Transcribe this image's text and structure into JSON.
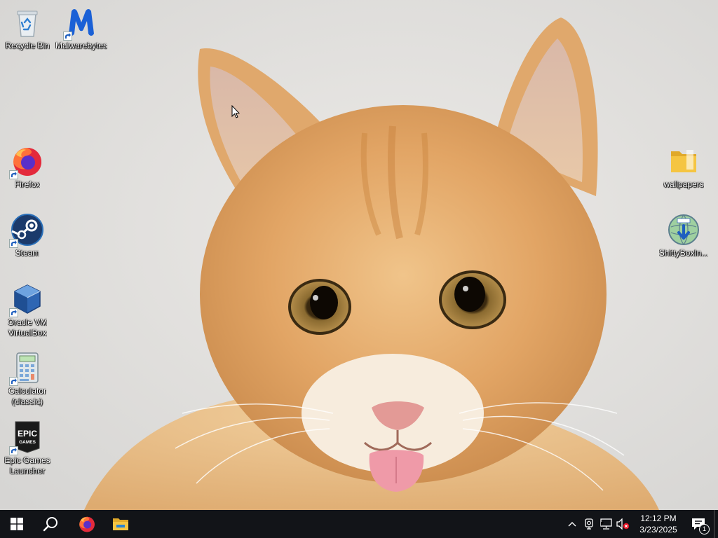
{
  "desktop": {
    "icons_left": [
      {
        "id": "recycle-bin",
        "label": "Recycle Bin",
        "icon": "recycle-bin-icon",
        "shortcut": false
      },
      {
        "id": "malwarebytes",
        "label": "Malwarebytes",
        "icon": "malwarebytes-icon",
        "shortcut": true
      },
      {
        "id": "firefox",
        "label": "Firefox",
        "icon": "firefox-icon",
        "shortcut": true
      },
      {
        "id": "steam",
        "label": "Steam",
        "icon": "steam-icon",
        "shortcut": true
      },
      {
        "id": "virtualbox",
        "label": "Oracle VM\nVirtualBox",
        "icon": "virtualbox-icon",
        "shortcut": true
      },
      {
        "id": "calculator",
        "label": "Calculator\n(classic)",
        "icon": "calculator-icon",
        "shortcut": true
      },
      {
        "id": "epic-games",
        "label": "Epic Games\nLauncher",
        "icon": "epic-games-icon",
        "shortcut": true
      }
    ],
    "icons_right": [
      {
        "id": "wallpapers",
        "label": "wallpapers",
        "icon": "folder-icon",
        "shortcut": false
      },
      {
        "id": "shittybox",
        "label": "ShittyBoxIn...",
        "icon": "installer-globe-icon",
        "shortcut": false
      }
    ],
    "epic_logo_text": [
      "EPIC",
      "GAMES"
    ]
  },
  "taskbar": {
    "start_icon": "windows-start-icon",
    "search_icon": "search-icon",
    "pinned": [
      {
        "id": "firefox",
        "icon": "firefox-icon"
      },
      {
        "id": "file-explorer",
        "icon": "file-explorer-icon"
      }
    ],
    "tray": {
      "chevron_icon": "chevron-up-icon",
      "icons": [
        "webcam-icon",
        "network-icon",
        "volume-muted-icon"
      ],
      "time": "12:12 PM",
      "date": "3/23/2025",
      "notification_count": "1"
    }
  },
  "colors": {
    "taskbar_bg": "#121418",
    "label_text": "#ffffff",
    "malwarebytes_blue": "#1a60d6",
    "steam_blue": "#1b3a6b",
    "folder_yellow": "#f5c542"
  }
}
